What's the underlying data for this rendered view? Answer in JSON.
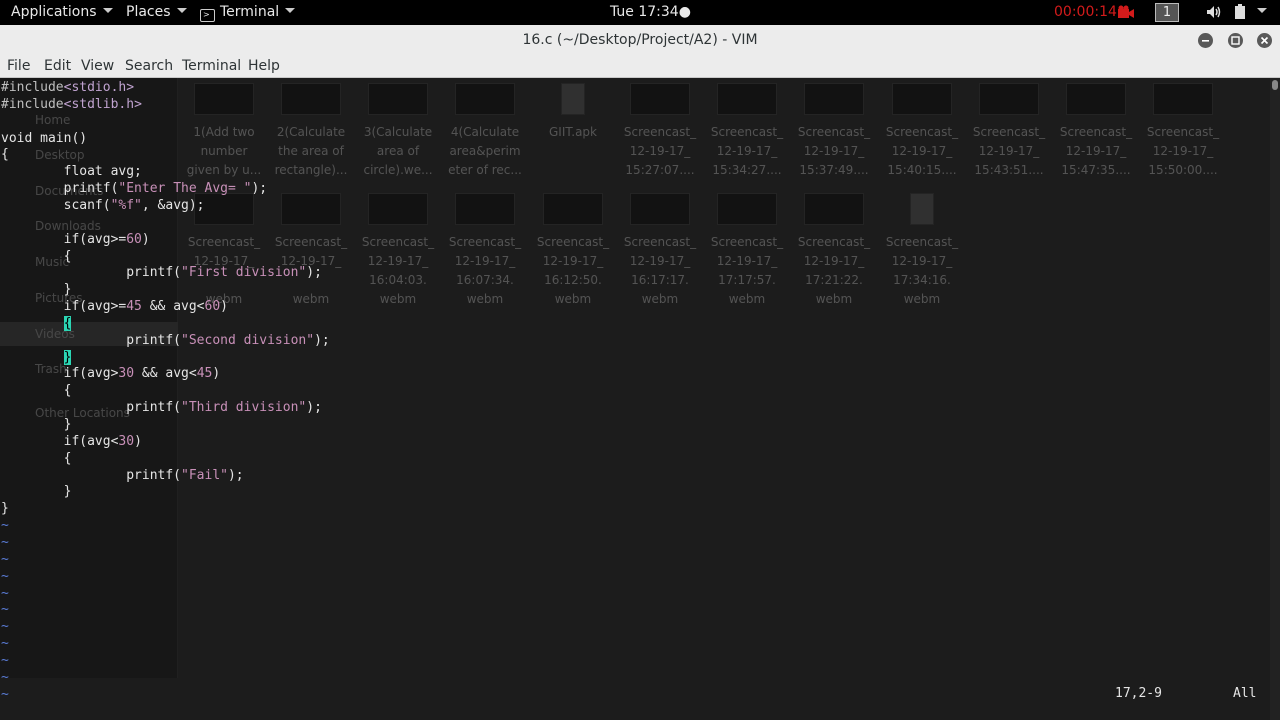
{
  "topbar": {
    "applications": "Applications",
    "places": "Places",
    "terminal": "Terminal",
    "clock": "Tue 17:34●",
    "recording_timer": "00:00:14",
    "workspace": "1",
    "icons": [
      "terminal-icon",
      "camera-icon",
      "volume-icon",
      "battery-icon",
      "power-icon"
    ]
  },
  "window": {
    "title": "16.c (~/Desktop/Project/A2) - VIM",
    "controls": [
      "minimize",
      "maximize",
      "close"
    ]
  },
  "menubar": [
    "File",
    "Edit",
    "View",
    "Search",
    "Terminal",
    "Help"
  ],
  "vim": {
    "lines": [
      "#include<stdio.h>",
      "#include<stdlib.h>",
      "",
      "void main()",
      "{",
      "        float avg;",
      "        printf(\"Enter The Avg= \");",
      "        scanf(\"%f\", &avg);",
      "",
      "        if(avg>=60)",
      "        {",
      "                printf(\"First division\");",
      "        }",
      "        if(avg>=45 && avg<60)",
      "        {",
      "                printf(\"Second division\");",
      "        }",
      "        if(avg>30 && avg<45)",
      "        {",
      "                printf(\"Third division\");",
      "        }",
      "        if(avg<30)",
      "        {",
      "                printf(\"Fail\");",
      "        }",
      "}"
    ],
    "tilde": "~",
    "status_position": "17,2-9",
    "status_scroll": "All"
  },
  "background_desktop": {
    "sidebar": [
      "Home",
      "Desktop",
      "Documents",
      "Downloads",
      "Music",
      "Pictures",
      "Videos",
      "Trash",
      "Other Locations"
    ],
    "files_row1": [
      [
        "1(Add two",
        "number",
        "given by u..."
      ],
      [
        "2(Calculate",
        "the area of",
        "rectangle)..."
      ],
      [
        "3(Calculate",
        "area of",
        "circle).we..."
      ],
      [
        "4(Calculate",
        "area&perim",
        "eter of rec..."
      ],
      [
        "GIIT.apk"
      ],
      [
        "Screencast_",
        "12-19-17_",
        "15:27:07...."
      ],
      [
        "Screencast_",
        "12-19-17_",
        "15:34:27...."
      ],
      [
        "Screencast_",
        "12-19-17_",
        "15:37:49...."
      ],
      [
        "Screencast_",
        "12-19-17_",
        "15:40:15...."
      ],
      [
        "Screencast_",
        "12-19-17_",
        "15:43:51...."
      ],
      [
        "Screencast_",
        "12-19-17_",
        "15:47:35...."
      ],
      [
        "Screencast_",
        "12-19-17_",
        "15:50:00...."
      ]
    ],
    "files_row2": [
      [
        "Screencast_",
        "12-19-17_",
        "",
        "webm"
      ],
      [
        "Screencast_",
        "12-19-17_",
        "",
        "webm"
      ],
      [
        "Screencast_",
        "12-19-17_",
        "16:04:03.",
        "webm"
      ],
      [
        "Screencast_",
        "12-19-17_",
        "16:07:34.",
        "webm"
      ],
      [
        "Screencast_",
        "12-19-17_",
        "16:12:50.",
        "webm"
      ],
      [
        "Screencast_",
        "12-19-17_",
        "16:17:17.",
        "webm"
      ],
      [
        "Screencast_",
        "12-19-17_",
        "17:17:57.",
        "webm"
      ],
      [
        "Screencast_",
        "12-19-17_",
        "17:21:22.",
        "webm"
      ],
      [
        "Screencast_",
        "12-19-17_",
        "17:34:16.",
        "webm"
      ]
    ]
  }
}
